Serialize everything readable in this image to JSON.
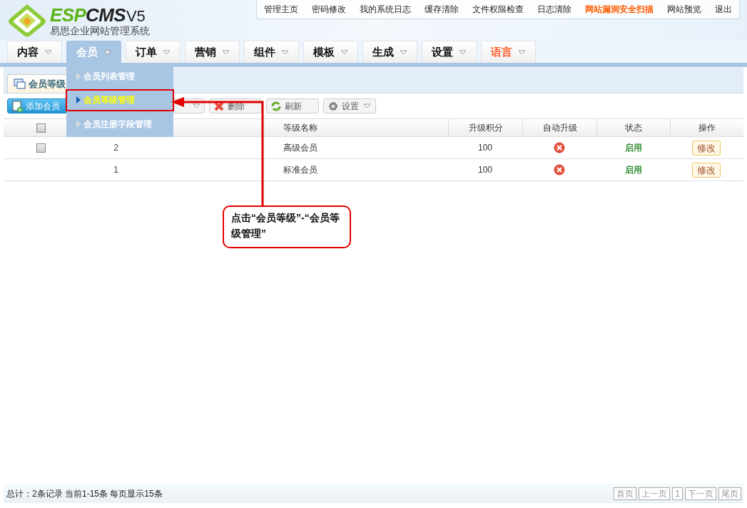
{
  "logo": {
    "part_a": "ESP",
    "part_b": "CMS",
    "version": "V5",
    "subtitle": "易思企业网站管理系统"
  },
  "top_links": [
    {
      "label": "管理主页",
      "highlight": false
    },
    {
      "label": "密码修改",
      "highlight": false
    },
    {
      "label": "我的系统日志",
      "highlight": false
    },
    {
      "label": "缓存清除",
      "highlight": false
    },
    {
      "label": "文件权限检查",
      "highlight": false
    },
    {
      "label": "日志清除",
      "highlight": false
    },
    {
      "label": "网站漏洞安全扫描",
      "highlight": true
    },
    {
      "label": "网站预览",
      "highlight": false
    },
    {
      "label": "退出",
      "highlight": false
    }
  ],
  "nav": [
    {
      "label": "内容",
      "selected": false,
      "highlight": false
    },
    {
      "label": "会员",
      "selected": true,
      "highlight": false
    },
    {
      "label": "订单",
      "selected": false,
      "highlight": false
    },
    {
      "label": "营销",
      "selected": false,
      "highlight": false
    },
    {
      "label": "组件",
      "selected": false,
      "highlight": false
    },
    {
      "label": "模板",
      "selected": false,
      "highlight": false
    },
    {
      "label": "生成",
      "selected": false,
      "highlight": false
    },
    {
      "label": "设置",
      "selected": false,
      "highlight": false
    },
    {
      "label": "语言",
      "selected": false,
      "highlight": true
    }
  ],
  "dropdown": {
    "items": [
      {
        "label": "会员列表管理",
        "selected": false
      },
      {
        "label": "会员等级管理",
        "selected": true
      },
      {
        "label": "会员注册字段管理",
        "selected": false
      }
    ]
  },
  "page_tab": {
    "label": "会员等级"
  },
  "toolbar": [
    {
      "kind": "add",
      "label": "添加会员"
    },
    {
      "kind": "filter"
    },
    {
      "kind": "delete",
      "label": "删除"
    },
    {
      "kind": "refresh",
      "label": "刷新"
    },
    {
      "kind": "settings",
      "label": "设置"
    }
  ],
  "table": {
    "select_all_checked": false,
    "columns": [
      "等级名称",
      "升级积分",
      "自动升级",
      "状态",
      "操作"
    ],
    "rows": [
      {
        "has_checkbox": true,
        "checked": false,
        "id": "2",
        "name": "高级会员",
        "points": "100",
        "auto_upgrade": false,
        "status": "启用",
        "action": "修改"
      },
      {
        "has_checkbox": false,
        "id": "1",
        "name": "标准会员",
        "points": "100",
        "auto_upgrade": false,
        "status": "启用",
        "action": "修改"
      }
    ]
  },
  "callout": "点击“会员等级”-“会员等级管理”",
  "footer": {
    "summary": "总计：2条记录 当前1-15条 每页显示15条",
    "pager": [
      "首页",
      "上一页",
      "1",
      "下一页",
      "尾页"
    ]
  }
}
